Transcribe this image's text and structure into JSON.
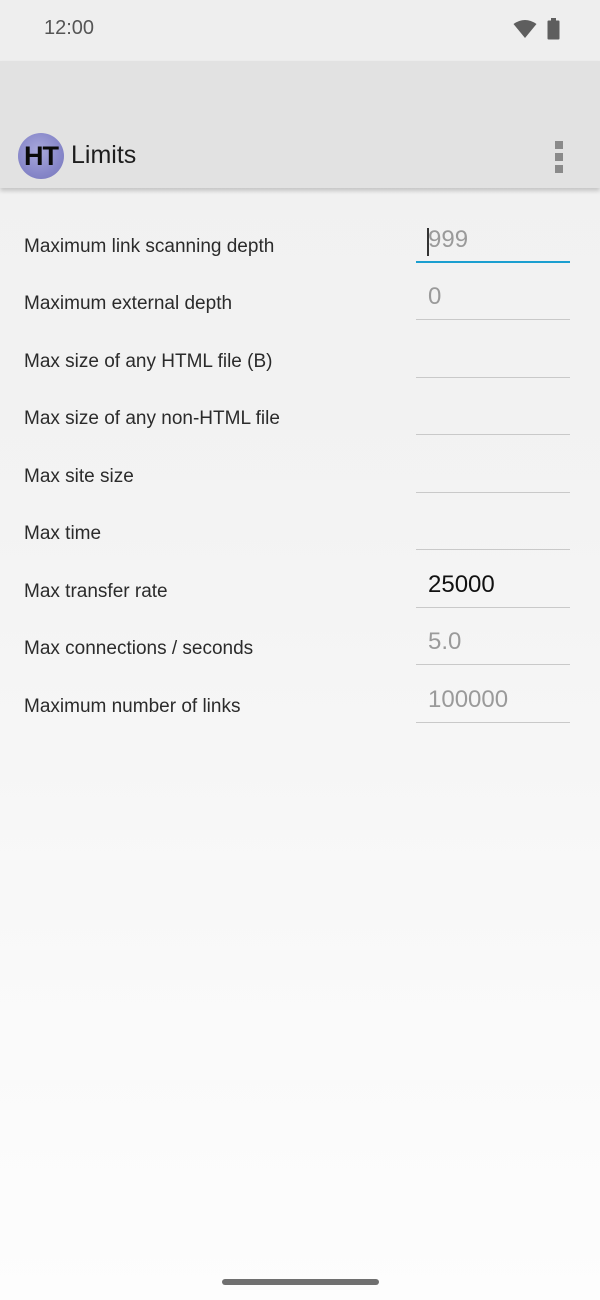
{
  "status_bar": {
    "time": "12:00"
  },
  "app_bar": {
    "logo_text": "HT",
    "title": "Limits"
  },
  "fields": [
    {
      "label": "Maximum link scanning depth",
      "value": "",
      "placeholder": "999"
    },
    {
      "label": "Maximum external depth",
      "value": "",
      "placeholder": "0"
    },
    {
      "label": "Max size of any HTML file (B)",
      "value": "",
      "placeholder": ""
    },
    {
      "label": "Max size of any non-HTML file",
      "value": "",
      "placeholder": ""
    },
    {
      "label": "Max site size",
      "value": "",
      "placeholder": ""
    },
    {
      "label": "Max time",
      "value": "",
      "placeholder": ""
    },
    {
      "label": "Max transfer rate",
      "value": "25000",
      "placeholder": ""
    },
    {
      "label": "Max connections / seconds",
      "value": "",
      "placeholder": "5.0"
    },
    {
      "label": "Maximum number of links",
      "value": "",
      "placeholder": "100000"
    }
  ],
  "colors": {
    "accent": "#1b9fd0",
    "app_bar": "#e2e2e2",
    "logo": "#8787c9"
  }
}
